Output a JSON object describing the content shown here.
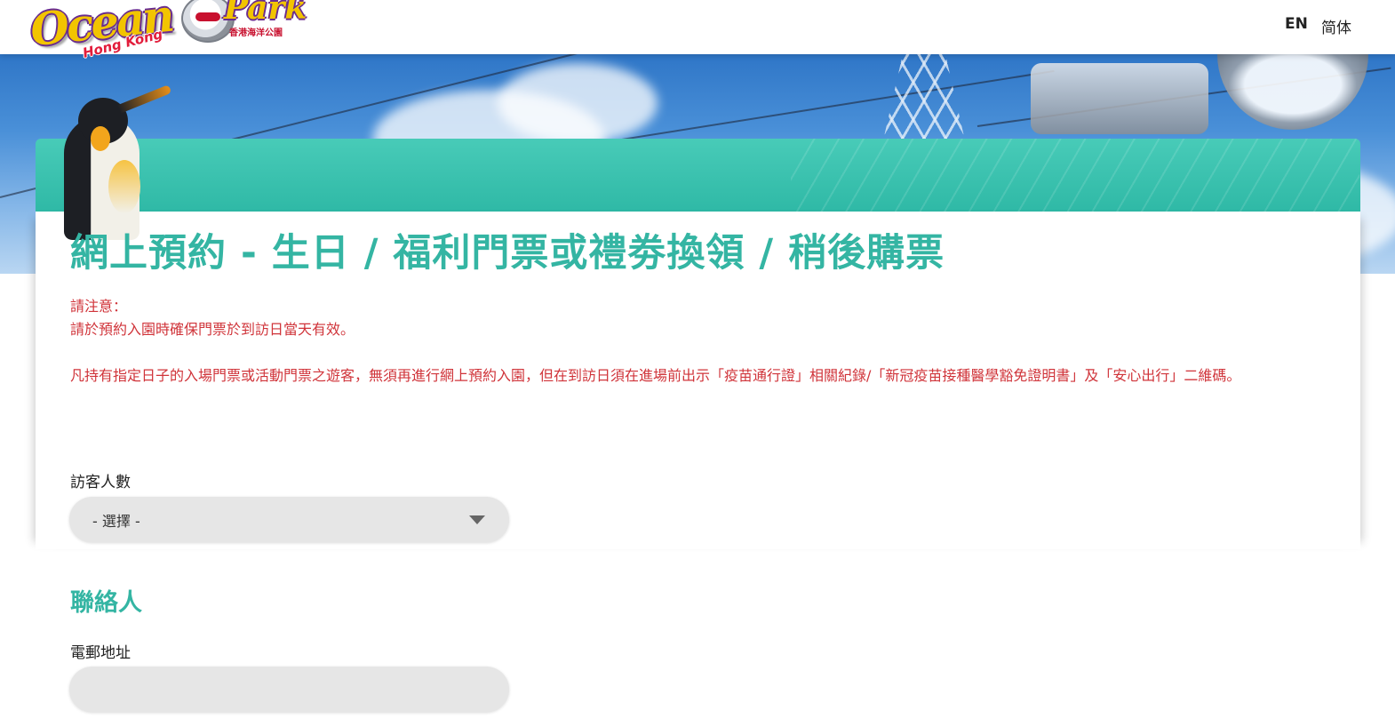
{
  "header": {
    "logo": {
      "word_ocean": "Ocean",
      "word_park": "Park",
      "word_hongkong": "Hong Kong",
      "chinese_name": "香港海洋公園"
    },
    "lang_en": "EN",
    "lang_sc": "简体"
  },
  "form": {
    "title": "網上預約 - 生日 / 福利門票或禮劵換領 / 稍後購票",
    "notice": {
      "heading": "請注意：",
      "line1": "請於預約入園時確保門票於到訪日當天有效。",
      "line2": "凡持有指定日子的入場門票或活動門票之遊客，無須再進行網上預約入園，但在到訪日須在進場前出示「疫苗通行證」相關紀錄/「新冠疫苗接種醫學豁免證明書」及「安心出行」二維碼。"
    },
    "visitors": {
      "label": "訪客人數",
      "selected": "- 選擇 -"
    },
    "contact": {
      "section_title": "聯絡人",
      "email_label": "電郵地址",
      "email_value": ""
    }
  },
  "colors": {
    "accent_teal": "#34b5a3",
    "notice_red": "#d0343a",
    "input_bg": "#e6e6e6"
  }
}
